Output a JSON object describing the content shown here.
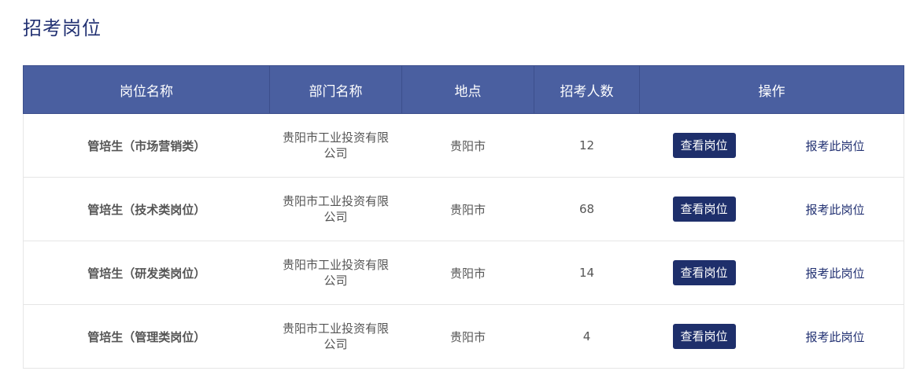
{
  "page": {
    "title": "招考岗位"
  },
  "table": {
    "headers": [
      "岗位名称",
      "部门名称",
      "地点",
      "招考人数",
      "操作"
    ],
    "rows": [
      {
        "position": "管培生（市场营销类）",
        "department": "贵阳市工业投资有限公司",
        "location": "贵阳市",
        "count": "12",
        "view": "查看岗位",
        "apply": "报考此岗位"
      },
      {
        "position": "管培生（技术类岗位）",
        "department": "贵阳市工业投资有限公司",
        "location": "贵阳市",
        "count": "68",
        "view": "查看岗位",
        "apply": "报考此岗位"
      },
      {
        "position": "管培生（研发类岗位）",
        "department": "贵阳市工业投资有限公司",
        "location": "贵阳市",
        "count": "14",
        "view": "查看岗位",
        "apply": "报考此岗位"
      },
      {
        "position": "管培生（管理类岗位）",
        "department": "贵阳市工业投资有限公司",
        "location": "贵阳市",
        "count": "4",
        "view": "查看岗位",
        "apply": "报考此岗位"
      }
    ]
  },
  "colors": {
    "header_bg": "#4a5fa0",
    "button_bg": "#1e2f6b",
    "title": "#233273"
  }
}
